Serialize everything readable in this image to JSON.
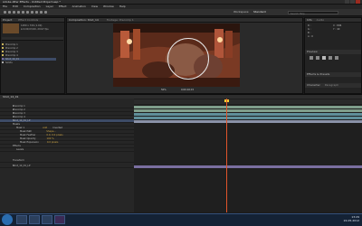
{
  "app": {
    "title": "Adobe After Effects - Untitled Project.aep *"
  },
  "menu": [
    "File",
    "Edit",
    "Composition",
    "Layer",
    "Effect",
    "Animation",
    "View",
    "Window",
    "Help"
  ],
  "toolbar": {
    "workspace_label": "Workspace:",
    "workspace_value": "Standard",
    "search_placeholder": "Search Help"
  },
  "project_panel": {
    "tab": "Project",
    "effect_tab": "Effect Controls",
    "info_lines": [
      "1280 x 720 (1.00)",
      "Δ 0;00;03;00, 29.97 fps"
    ],
    "items": [
      "Precomp 1",
      "Precomp 2",
      "Precomp 3",
      "Precomp 4",
      "Shot_14_01",
      "Solids"
    ]
  },
  "viewer": {
    "tab": "Composition: Shot_14",
    "sub_tab": "Footage: Precomp 1",
    "zoom": "50%",
    "timecode": "0;00;02;15"
  },
  "right_panel": {
    "info_tab": "Info",
    "audio_tab": "Audio",
    "values": [
      "R :",
      "G :",
      "B :",
      "A : 0",
      "X : 896",
      "Y : 40"
    ],
    "preview_tab": "Preview",
    "effects_tab": "Effects & Presets",
    "char_tab": "Character",
    "para_tab": "Paragraph"
  },
  "timeline": {
    "tab": "Shot_14_01",
    "timecode": "0;00;01;16",
    "columns": [
      "Source Name",
      "Mode",
      "T",
      "TrkMat",
      "Parent"
    ],
    "layers": [
      {
        "name": "Precomp 1",
        "sel": false
      },
      {
        "name": "Precomp 2",
        "sel": false
      },
      {
        "name": "Precomp 3",
        "sel": false
      },
      {
        "name": "Precomp 4",
        "sel": false
      },
      {
        "name": "Shot_14_01_LP",
        "sel": true
      },
      {
        "name": "Masks",
        "sel": false
      },
      {
        "name": "Mask 1",
        "sel": false
      },
      {
        "name": "Mask Path",
        "sel": false
      },
      {
        "name": "Mask Feather",
        "sel": false
      },
      {
        "name": "Mask Opacity",
        "sel": false
      },
      {
        "name": "Mask Expansion",
        "sel": false
      },
      {
        "name": "Effects",
        "sel": false
      },
      {
        "name": "Levels",
        "sel": false
      },
      {
        "name": "Transform",
        "sel": false
      },
      {
        "name": "Shot_14_01_LP",
        "sel": false
      }
    ],
    "values": [
      "Add",
      "Inverted",
      "Shape...",
      "0.0, 0.0 pixels",
      "100 %",
      "0.0 pixels"
    ]
  },
  "taskbar": {
    "time": "13:29",
    "date": "22-05-2012"
  },
  "colors": {
    "accent_selection": "#3d4b66",
    "bar_green": "#7f9e8b",
    "bar_teal": "#5f8f9a",
    "bar_purple": "#7a6fa0",
    "playhead": "#e0552b",
    "label_yellow": "#c9b45a"
  }
}
